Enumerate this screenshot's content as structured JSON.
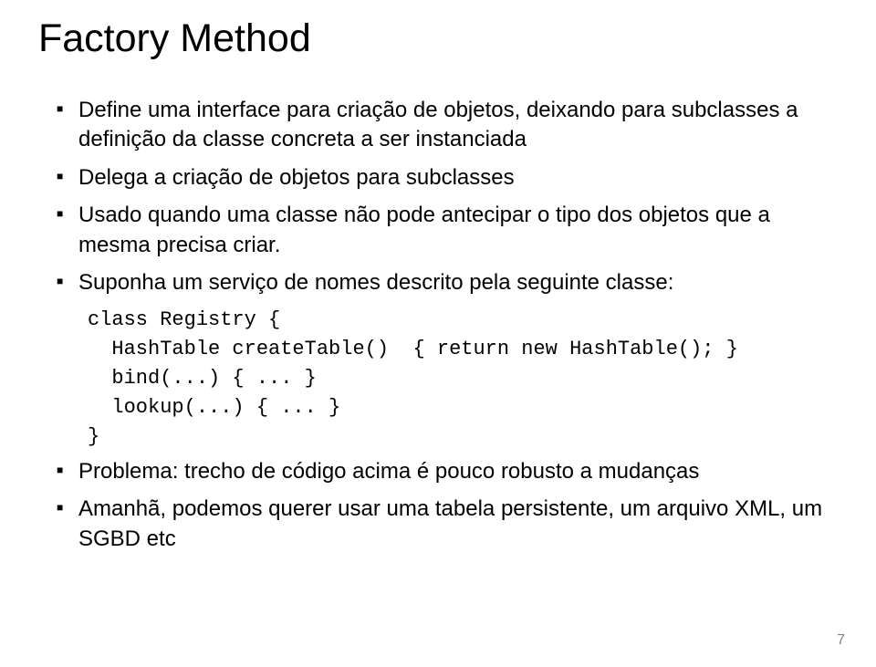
{
  "title": "Factory Method",
  "bullets": {
    "b1": "Define uma interface para criação de objetos, deixando para subclasses a definição da classe concreta a ser instanciada",
    "b2": "Delega a criação de objetos para subclasses",
    "b3": "Usado quando uma classe não pode antecipar o tipo dos objetos que a mesma precisa criar.",
    "b4": "Suponha um serviço de nomes descrito pela seguinte classe:",
    "b5": "Problema: trecho de código acima é pouco robusto  a mudanças",
    "b6": "Amanhã, podemos querer usar uma tabela persistente, um arquivo XML, um SGBD etc"
  },
  "code": {
    "l1": "class Registry {",
    "l2": "  HashTable createTable()  { return new HashTable(); }",
    "l3": "  bind(...) { ... }",
    "l4": "  lookup(...) { ... }",
    "l5": "}"
  },
  "page_number": "7"
}
